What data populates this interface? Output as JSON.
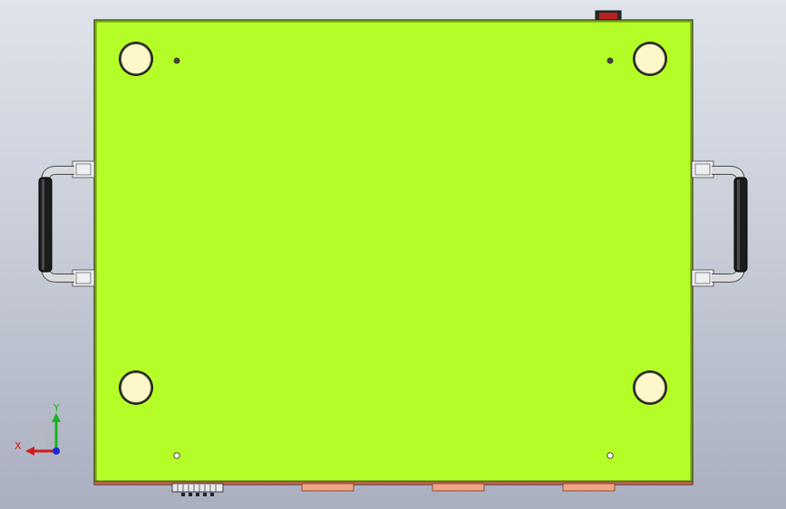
{
  "viewport": {
    "background_top": "#dfe3ea",
    "background_bottom": "#a9afbf"
  },
  "model": {
    "plate_color": "#b5fd27",
    "plate_edge_color": "#4d6b10",
    "foot_color": "#fdf7c9",
    "handle_grip_color": "#1c1c1c",
    "handle_metal_color": "#d8dadd",
    "connector_color": "#f0a585",
    "switch_color": "#b92020"
  },
  "triad": {
    "x_label": "X",
    "y_label": "Y",
    "x_color": "#d11a1a",
    "y_color": "#19b51f",
    "z_color": "#1a2ad6"
  }
}
